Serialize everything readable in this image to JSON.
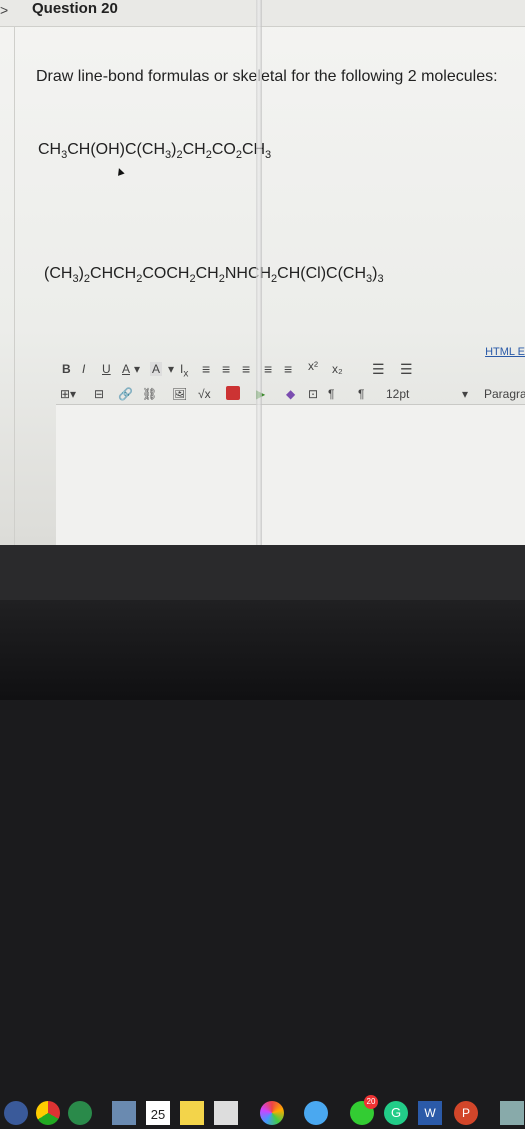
{
  "header": {
    "title": "Question 20"
  },
  "question": {
    "prompt": "Draw line-bond formulas or skeletal for the following 2 molecules:",
    "molecule_1": "CH3CH(OH)C(CH3)2CH2CO2CH3",
    "molecule_2": "(CH3)2CHCH2COCH2CH2NHCH2CH(Cl)C(CH3)3"
  },
  "editor": {
    "html_editor_label": "HTML E",
    "font_size": "12pt",
    "paragraph": "Paragra",
    "toolbar_row1": [
      "B",
      "I",
      "U",
      "A",
      "A",
      "Tx",
      "≡",
      "≡",
      "≡",
      "≡",
      "≡",
      "x²",
      "x₂",
      "☰",
      "☰"
    ],
    "toolbar_row2": [
      "⊞",
      "⊟",
      "🔗",
      "⛓",
      "🖼",
      "√x",
      "▶",
      "⬥",
      "▾",
      "⊡",
      "¶",
      "¶",
      "12pt",
      "▾",
      "Paragra"
    ]
  },
  "taskbar": {
    "calendar_day": "25",
    "badge_count": "20",
    "word_letter": "W",
    "powerpoint_letter": "P"
  }
}
